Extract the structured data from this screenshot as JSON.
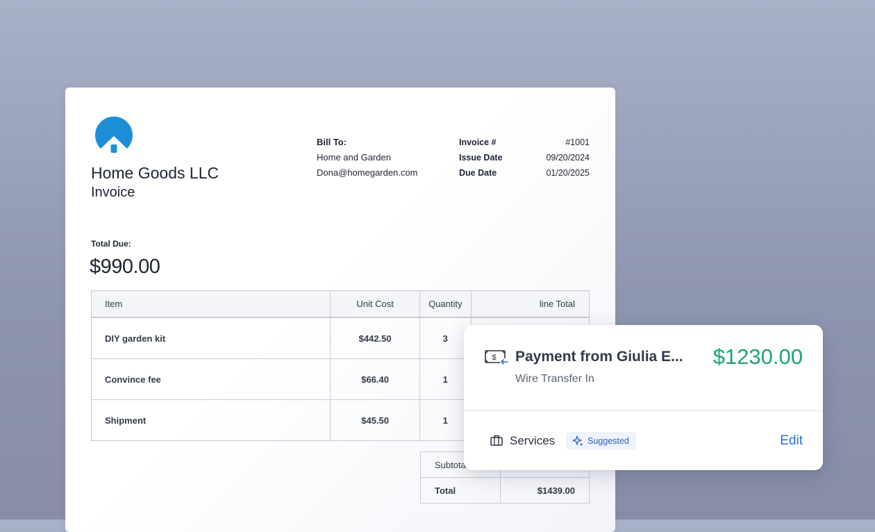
{
  "invoice": {
    "company": "Home Goods LLC",
    "doc_type": "Invoice",
    "logo_icon": "home-dome-logo",
    "brand_color": "#1e8ed8",
    "bill_to": {
      "label": "Bill To:",
      "name": "Home and Garden",
      "email": "Dona@homegarden.com"
    },
    "meta": [
      {
        "label": "Invoice #",
        "value": "#1001"
      },
      {
        "label": "Issue Date",
        "value": "09/20/2024"
      },
      {
        "label": "Due Date",
        "value": "01/20/2025"
      }
    ],
    "total_due_label": "Total Due:",
    "total_due_value": "$990.00",
    "table": {
      "headers": [
        "Item",
        "Unit Cost",
        "Quantity",
        "line Total"
      ],
      "rows": [
        {
          "item": "DIY garden kit",
          "unit_cost": "$442.50",
          "quantity": "3"
        },
        {
          "item": "Convince fee",
          "unit_cost": "$66.40",
          "quantity": "1"
        },
        {
          "item": "Shipment",
          "unit_cost": "$45.50",
          "quantity": "1"
        }
      ]
    },
    "totals": {
      "subtotal_label": "Subtota",
      "total_label": "Total",
      "total_value": "$1439.00"
    }
  },
  "payment": {
    "icon": "money-transfer-icon",
    "title": "Payment from Giulia E...",
    "amount": "$1230.00",
    "amount_color": "#17a673",
    "subtitle": "Wire Transfer In",
    "category_icon": "briefcase-icon",
    "category": "Services",
    "badge_icon": "sparkle-icon",
    "badge": "Suggested",
    "edit_label": "Edit",
    "edit_color": "#2770d8"
  }
}
